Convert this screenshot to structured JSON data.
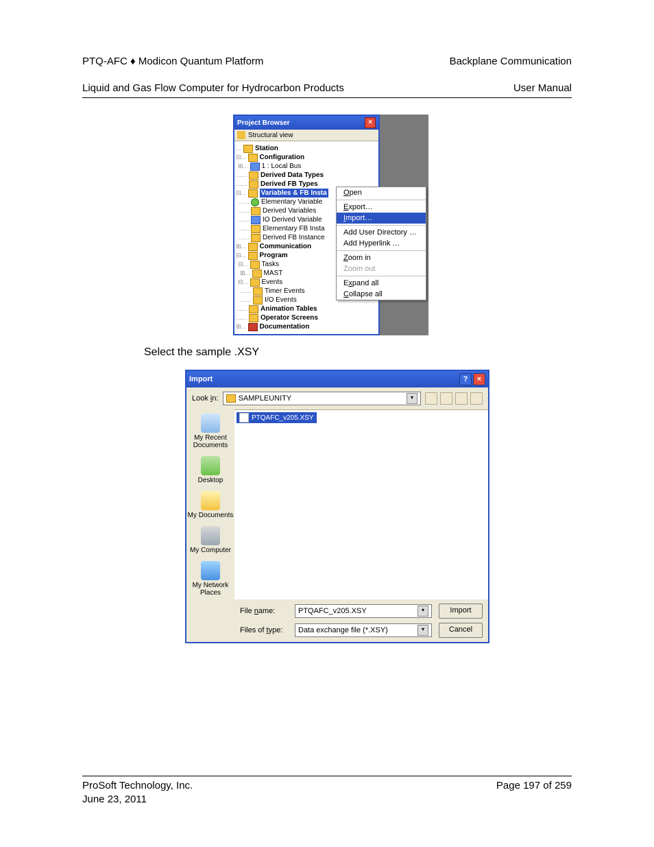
{
  "header": {
    "left_line1": "PTQ-AFC ♦ Modicon Quantum Platform",
    "left_line2": "Liquid and Gas Flow Computer for Hydrocarbon Products",
    "right_line1": "Backplane Communication",
    "right_line2": "User Manual"
  },
  "footer": {
    "left_line1": "ProSoft Technology, Inc.",
    "left_line2": "June 23, 2011",
    "right": "Page 197 of 259"
  },
  "body_text": "Select the sample .XSY",
  "project_browser": {
    "title": "Project Browser",
    "toolbar_label": "Structural view",
    "tree": {
      "root": "Station",
      "config": "Configuration",
      "local_bus": "1 : Local Bus",
      "derived_data": "Derived Data Types",
      "derived_fb_types": "Derived FB Types",
      "vars_fb": "Variables & FB Insta",
      "elem_vars": "Elementary Variable",
      "derived_vars": "Derived Variables",
      "io_derived": "IO Derived Variable",
      "elem_fb_inst": "Elementary FB Insta",
      "derived_fb_inst": "Derived FB Instance",
      "communication": "Communication",
      "program": "Program",
      "tasks": "Tasks",
      "mast": "MAST",
      "events": "Events",
      "timer_events": "Timer Events",
      "io_events": "I/O Events",
      "anim_tables": "Animation Tables",
      "op_screens": "Operator Screens",
      "documentation": "Documentation"
    },
    "context_menu": {
      "open": "Open",
      "export": "Export…",
      "import": "Import…",
      "add_user_dir": "Add User Directory …",
      "add_hyperlink": "Add Hyperlink …",
      "zoom_in": "Zoom in",
      "zoom_out": "Zoom out",
      "expand_all": "Expand all",
      "collapse_all": "Collapse all"
    }
  },
  "import_dialog": {
    "title": "Import",
    "look_in_label": "Look in:",
    "look_in_value": "SAMPLEUNITY",
    "file_list": [
      "PTQAFC_v205.XSY"
    ],
    "places": {
      "recent": "My Recent Documents",
      "desktop": "Desktop",
      "mydocs": "My Documents",
      "mycomp": "My Computer",
      "mynet": "My Network Places"
    },
    "filename_label": "File name:",
    "filename_value": "PTQAFC_v205.XSY",
    "filetype_label": "Files of type:",
    "filetype_value": "Data exchange file (*.XSY)",
    "import_btn": "Import",
    "cancel_btn": "Cancel"
  }
}
